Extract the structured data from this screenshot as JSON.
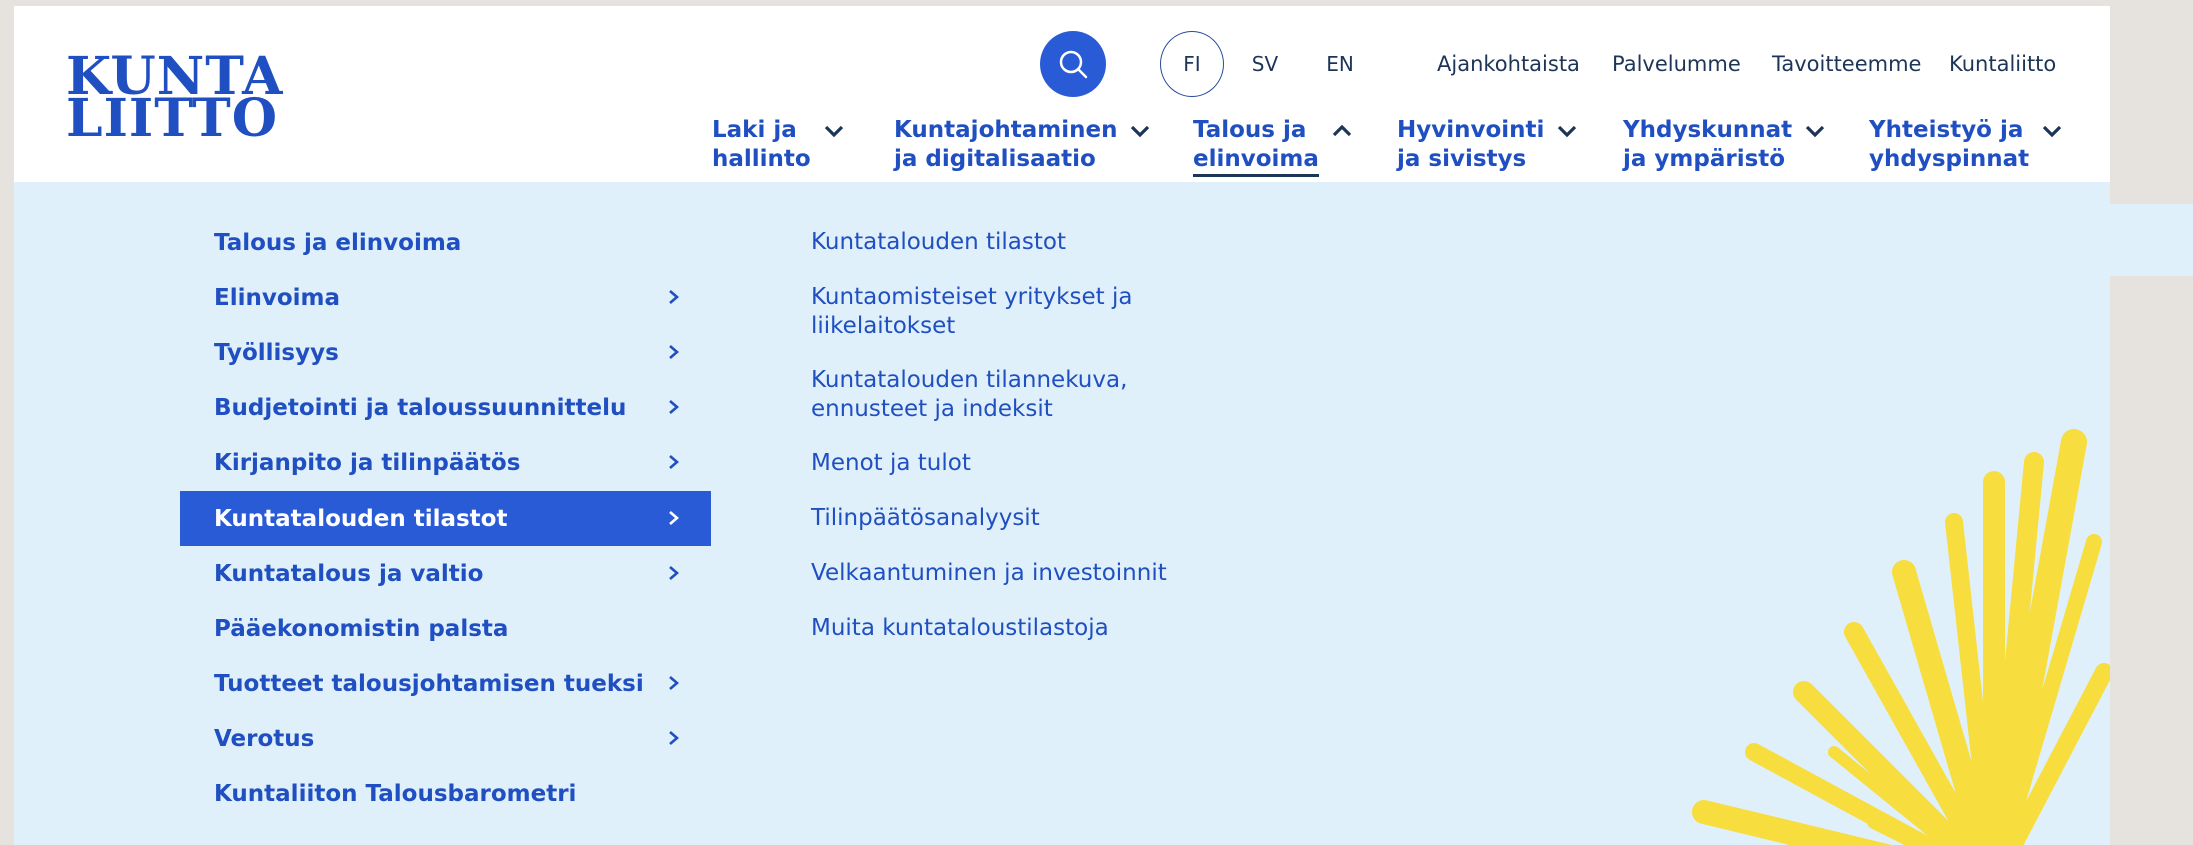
{
  "logo": {
    "line1": "KUNTA",
    "line2": "LIITTO"
  },
  "colors": {
    "accent": "#2a5bd7",
    "menu_bg": "#e0f0fa",
    "text": "#1f4fc1",
    "sun": "#f7dd3e"
  },
  "search": {
    "icon": "search-icon"
  },
  "languages": [
    {
      "code": "FI"
    },
    {
      "code": "SV"
    },
    {
      "code": "EN"
    }
  ],
  "utility_nav": [
    "Ajankohtaista",
    "Palvelumme",
    "Tavoitteemme",
    "Kuntaliitto"
  ],
  "main_nav": [
    {
      "line1": "Laki ja",
      "line2": "hallinto",
      "icon": "chevron-down-icon"
    },
    {
      "line1": "Kuntajohtaminen",
      "line2": "ja digitalisaatio",
      "icon": "chevron-down-icon"
    },
    {
      "line1": "Talous ja",
      "line2": "elinvoima",
      "icon": "chevron-up-icon",
      "active": true
    },
    {
      "line1": "Hyvinvointi",
      "line2": "ja sivistys",
      "icon": "chevron-down-icon"
    },
    {
      "line1": "Yhdyskunnat",
      "line2": "ja ympäristö",
      "icon": "chevron-down-icon"
    },
    {
      "line1": "Yhteistyö ja",
      "line2": "yhdyspinnat",
      "icon": "chevron-down-icon"
    }
  ],
  "submenu_left": [
    {
      "label": "Talous ja elinvoima",
      "has_children": false
    },
    {
      "label": "Elinvoima",
      "has_children": true
    },
    {
      "label": "Työllisyys",
      "has_children": true
    },
    {
      "label": "Budjetointi ja taloussuunnittelu",
      "has_children": true
    },
    {
      "label": "Kirjanpito ja tilinpäätös",
      "has_children": true
    },
    {
      "label": "Kuntatalouden tilastot",
      "has_children": true,
      "active": true
    },
    {
      "label": "Kuntatalous ja valtio",
      "has_children": true
    },
    {
      "label": "Pääekonomistin palsta",
      "has_children": false
    },
    {
      "label": "Tuotteet talousjohtamisen tueksi",
      "has_children": true
    },
    {
      "label": "Verotus",
      "has_children": true
    },
    {
      "label": "Kuntaliiton Talousbarometri",
      "has_children": false
    }
  ],
  "submenu_right": [
    {
      "line1": "Kuntatalouden tilastot",
      "line2": ""
    },
    {
      "line1": "Kuntaomisteiset yritykset ja",
      "line2": "liikelaitokset"
    },
    {
      "line1": "Kuntatalouden tilannekuva,",
      "line2": "ennusteet ja indeksit"
    },
    {
      "line1": "Menot ja tulot",
      "line2": ""
    },
    {
      "line1": "Tilinpäätösanalyysit",
      "line2": ""
    },
    {
      "line1": "Velkaantuminen ja investoinnit",
      "line2": ""
    },
    {
      "line1": "Muita kuntataloustilastoja",
      "line2": ""
    }
  ]
}
